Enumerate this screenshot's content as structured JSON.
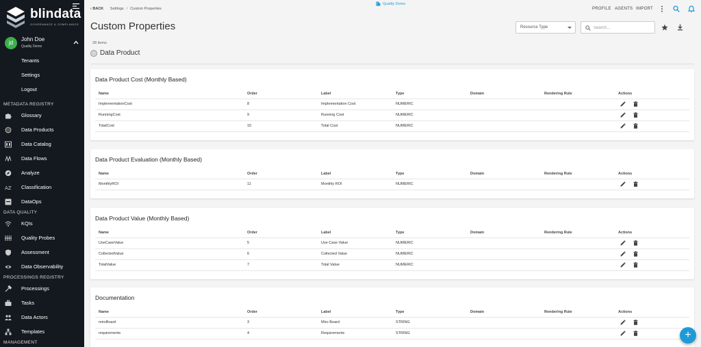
{
  "app": {
    "logo_text": "blindata",
    "logo_sub": "GOVERNANCE & COMPLIANCE",
    "tenant": "Quality Demo"
  },
  "user": {
    "initials": "jd",
    "name": "John Doe",
    "tenant": "Quality Demo"
  },
  "user_menu": [
    "Tenants",
    "Settings",
    "Logout"
  ],
  "sidebar": {
    "sections": [
      {
        "title": "METADATA REGISTRY",
        "items": [
          "Glossary",
          "Data Products",
          "Data Catalog",
          "Data Flows",
          "Analyze",
          "Classification",
          "DataOps"
        ]
      },
      {
        "title": "DATA QUALITY",
        "items": [
          "KQIs",
          "Quality Probes",
          "Assessment",
          "Data Observability"
        ]
      },
      {
        "title": "PROCESSINGS REGISTRY",
        "items": [
          "Processings",
          "Tasks",
          "Data Actors",
          "Templates"
        ]
      },
      {
        "title": "MANAGEMENT",
        "items": []
      }
    ]
  },
  "topbar": {
    "back": "BACK",
    "breadcrumb": [
      "Settings",
      "Custom Properties"
    ],
    "nav": [
      "PROFILE",
      "AGENTS",
      "IMPORT"
    ]
  },
  "page": {
    "title": "Custom Properties",
    "resource_type_label": "Resource Type",
    "search_placeholder": "Search...",
    "items_count": "28 items",
    "filter_label": "Data Product"
  },
  "table_headers": [
    "Name",
    "Order",
    "Label",
    "Type",
    "Domain",
    "Rendering Rule",
    "Actions"
  ],
  "groups": [
    {
      "title": "Data Product Cost (Monthly Based)",
      "rows": [
        {
          "name": "ImplementationCost",
          "order": "8",
          "label": "Implementation Cost",
          "type": "NUMERIC",
          "domain": "",
          "rule": ""
        },
        {
          "name": "RunningCost",
          "order": "9",
          "label": "Running Cost",
          "type": "NUMERIC",
          "domain": "",
          "rule": ""
        },
        {
          "name": "TotalCost",
          "order": "10",
          "label": "Total Cost",
          "type": "NUMERIC",
          "domain": "",
          "rule": ""
        }
      ]
    },
    {
      "title": "Data Product Evaluation (Monthly Based)",
      "rows": [
        {
          "name": "MonthlyROI",
          "order": "11",
          "label": "Monthly ROI",
          "type": "NUMERIC",
          "domain": "",
          "rule": ""
        }
      ]
    },
    {
      "title": "Data Product Value (Monthly Based)",
      "rows": [
        {
          "name": "UseCaseValue",
          "order": "5",
          "label": "Use Case Value",
          "type": "NUMERIC",
          "domain": "",
          "rule": ""
        },
        {
          "name": "CollectedValue",
          "order": "6",
          "label": "Collected Value",
          "type": "NUMERIC",
          "domain": "",
          "rule": ""
        },
        {
          "name": "TotalValue",
          "order": "7",
          "label": "Total Value",
          "type": "NUMERIC",
          "domain": "",
          "rule": ""
        }
      ]
    },
    {
      "title": "Documentation",
      "rows": [
        {
          "name": "miroBoard",
          "order": "3",
          "label": "Miro Board",
          "type": "STRING",
          "domain": "",
          "rule": ""
        },
        {
          "name": "requirements",
          "order": "4",
          "label": "Requirements",
          "type": "STRING",
          "domain": "",
          "rule": ""
        }
      ]
    }
  ],
  "fab_label": "+",
  "colors": {
    "accent": "#1e9bd7",
    "sidebar_bg": "#14191f",
    "avatar": "#3cb04a"
  }
}
